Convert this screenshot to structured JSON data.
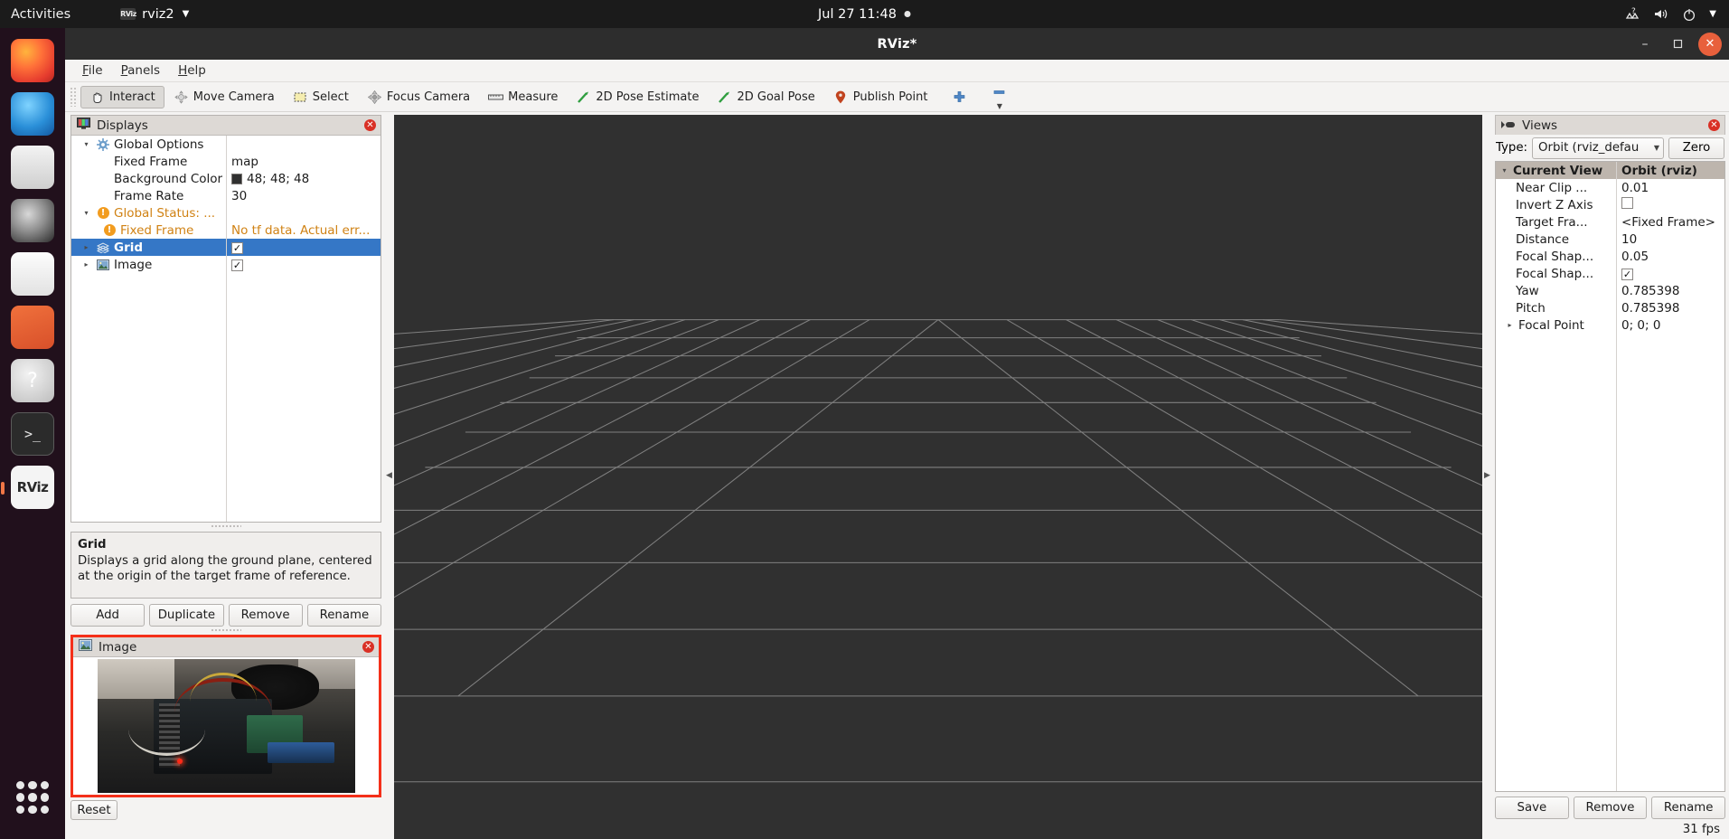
{
  "topbar": {
    "activities": "Activities",
    "app_name": "rviz2",
    "app_icon": "rviz-icon",
    "clock": "Jul 27  11:48",
    "icons": [
      "network-icon",
      "volume-icon",
      "power-icon",
      "chevron-down-icon"
    ]
  },
  "dock": {
    "items": [
      {
        "name": "firefox",
        "label": "Firefox"
      },
      {
        "name": "thunderbird",
        "label": "Thunderbird Mail"
      },
      {
        "name": "files",
        "label": "Files"
      },
      {
        "name": "rhythmbox",
        "label": "Rhythmbox"
      },
      {
        "name": "writer",
        "label": "LibreOffice Writer"
      },
      {
        "name": "software",
        "label": "Ubuntu Software"
      },
      {
        "name": "help",
        "label": "Help"
      },
      {
        "name": "terminal",
        "label": "Terminal"
      },
      {
        "name": "rviz",
        "label": "RViz"
      }
    ],
    "show_apps": "Show Applications"
  },
  "window": {
    "title": "RViz*",
    "minimize": "–",
    "maximize": "❐",
    "close": "✕"
  },
  "menubar": [
    {
      "label": "File",
      "mnemonic": "F"
    },
    {
      "label": "Panels",
      "mnemonic": "P"
    },
    {
      "label": "Help",
      "mnemonic": "H"
    }
  ],
  "toolbar": {
    "buttons": [
      {
        "label": "Interact",
        "icon": "hand-icon",
        "pressed": true
      },
      {
        "label": "Move Camera",
        "icon": "move-camera-icon",
        "pressed": false
      },
      {
        "label": "Select",
        "icon": "select-rect-icon",
        "pressed": false
      },
      {
        "label": "Focus Camera",
        "icon": "focus-camera-icon",
        "pressed": false
      },
      {
        "label": "Measure",
        "icon": "ruler-icon",
        "pressed": false
      },
      {
        "label": "2D Pose Estimate",
        "icon": "green-arrow-icon",
        "pressed": false
      },
      {
        "label": "2D Goal Pose",
        "icon": "green-arrow-icon",
        "pressed": false
      },
      {
        "label": "Publish Point",
        "icon": "map-pin-icon",
        "pressed": false
      }
    ],
    "add_tool": "+",
    "remove_tool": "−"
  },
  "displays": {
    "title": "Displays",
    "icon": "displays-icon",
    "close": "✕",
    "rows": [
      {
        "name": "Global Options",
        "value": "",
        "indent": 0,
        "arrow": "open",
        "icon": "gear-icon",
        "kind": "group"
      },
      {
        "name": "Fixed Frame",
        "value": "map",
        "indent": 1,
        "arrow": "none",
        "icon": "none",
        "kind": "prop"
      },
      {
        "name": "Background Color",
        "value": "48; 48; 48",
        "indent": 1,
        "arrow": "none",
        "icon": "none",
        "kind": "color",
        "swatch": "#303030"
      },
      {
        "name": "Frame Rate",
        "value": "30",
        "indent": 1,
        "arrow": "none",
        "icon": "none",
        "kind": "prop"
      },
      {
        "name": "Global Status: ...",
        "value": "",
        "indent": 0,
        "arrow": "open",
        "icon": "warning-icon",
        "kind": "status"
      },
      {
        "name": "Fixed Frame",
        "value": "No tf data.  Actual err...",
        "indent": 1,
        "arrow": "none",
        "icon": "warning-icon",
        "kind": "status"
      },
      {
        "name": "Grid",
        "value": "checked",
        "indent": 0,
        "arrow": "closed",
        "icon": "grid-icon",
        "kind": "display",
        "selected": true
      },
      {
        "name": "Image",
        "value": "checked",
        "indent": 0,
        "arrow": "closed",
        "icon": "image-icon",
        "kind": "display",
        "selected": false
      }
    ],
    "description": {
      "title": "Grid",
      "text": "Displays a grid along the ground plane, centered at the origin of the target frame of reference."
    },
    "buttons": [
      "Add",
      "Duplicate",
      "Remove",
      "Rename"
    ]
  },
  "image_panel": {
    "title": "Image",
    "icon": "image-icon",
    "close": "✕",
    "border_color": "#f4301a"
  },
  "reset_button": "Reset",
  "views": {
    "title": "Views",
    "icon": "views-icon",
    "close": "✕",
    "type_label": "Type:",
    "type_value": "Orbit (rviz_defau",
    "zero_button": "Zero",
    "header": {
      "name": "Current View",
      "value": "Orbit (rviz)"
    },
    "rows": [
      {
        "name": "Near Clip ...",
        "value": "0.01",
        "kind": "prop"
      },
      {
        "name": "Invert Z Axis",
        "value": "unchecked",
        "kind": "bool"
      },
      {
        "name": "Target Fra...",
        "value": "<Fixed Frame>",
        "kind": "prop"
      },
      {
        "name": "Distance",
        "value": "10",
        "kind": "prop"
      },
      {
        "name": "Focal Shap...",
        "value": "0.05",
        "kind": "prop"
      },
      {
        "name": "Focal Shap...",
        "value": "checked",
        "kind": "bool"
      },
      {
        "name": "Yaw",
        "value": "0.785398",
        "kind": "prop"
      },
      {
        "name": "Pitch",
        "value": "0.785398",
        "kind": "prop"
      },
      {
        "name": "Focal Point",
        "value": "0; 0; 0",
        "kind": "expand"
      }
    ],
    "buttons": [
      "Save",
      "Remove",
      "Rename"
    ]
  },
  "statusbar": {
    "fps": "31 fps"
  },
  "colors": {
    "accent_orange": "#f07746",
    "selection_blue": "#3577c6",
    "status_warning": "#f29c1f",
    "viewport_bg": "#303030",
    "panel_border_red": "#f4301a"
  }
}
